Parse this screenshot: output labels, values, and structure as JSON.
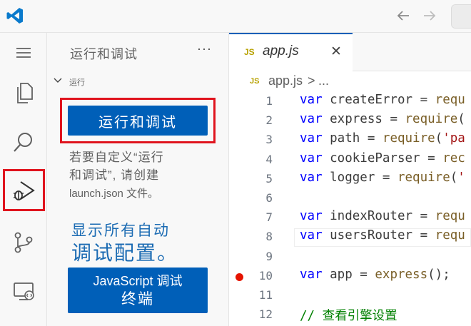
{
  "titlebar": {},
  "sidebar": {
    "title": "运行和调试",
    "more": "···",
    "section_title": "运行",
    "run_button": "运行和调试",
    "hint_line1": "若要自定义“运行",
    "hint_line2": "和调试”, 请创建",
    "hint_line3": "launch.json 文件。",
    "show_all_line1": "显示所有自动",
    "show_all_line2": "调试配置。",
    "js_button_line1": "JavaScript 调试",
    "js_button_line2": "终端"
  },
  "editor": {
    "tab_icon": "JS",
    "tab_name": "app.js",
    "tab_close": "✕",
    "breadcrumb_icon": "JS",
    "breadcrumb_file": "app.js",
    "breadcrumb_sep": ">",
    "breadcrumb_more": "...",
    "lines": [
      {
        "num": "1",
        "kw": "var",
        "name": " createError",
        "eq": " = ",
        "fn": "requ",
        "tail": ""
      },
      {
        "num": "2",
        "kw": "var",
        "name": " express",
        "eq": " = ",
        "fn": "require",
        "tail": "("
      },
      {
        "num": "3",
        "kw": "var",
        "name": " path",
        "eq": " = ",
        "fn": "require",
        "tail": "('pa"
      },
      {
        "num": "4",
        "kw": "var",
        "name": " cookieParser",
        "eq": " = ",
        "fn": "rec",
        "tail": ""
      },
      {
        "num": "5",
        "kw": "var",
        "name": " logger",
        "eq": " = ",
        "fn": "require",
        "tail": "('"
      },
      {
        "num": "6",
        "kw": "",
        "name": "",
        "eq": "",
        "fn": "",
        "tail": ""
      },
      {
        "num": "7",
        "kw": "var",
        "name": " indexRouter",
        "eq": " = ",
        "fn": "requ",
        "tail": ""
      },
      {
        "num": "8",
        "kw": "var",
        "name": " usersRouter",
        "eq": " = ",
        "fn": "requ",
        "tail": ""
      },
      {
        "num": "9",
        "kw": "",
        "name": "",
        "eq": "",
        "fn": "",
        "tail": ""
      },
      {
        "num": "10",
        "kw": "var",
        "name": " app",
        "eq": " = ",
        "fn": "express",
        "tail": "();"
      },
      {
        "num": "11",
        "kw": "",
        "name": "",
        "eq": "",
        "fn": "",
        "tail": ""
      },
      {
        "num": "12",
        "comment": "// 查看引擎设置"
      }
    ]
  },
  "icons": {
    "logo": "vscode-logo-icon",
    "back": "arrow-left-icon",
    "forward": "arrow-right-icon",
    "menu": "hamburger-menu-icon",
    "explorer": "files-icon",
    "search": "search-icon",
    "debug": "run-debug-icon",
    "scm": "source-control-icon",
    "remote": "remote-explorer-icon"
  },
  "colors": {
    "accent": "#005fb8",
    "highlight_box": "#e0141e",
    "breakpoint": "#e51400"
  }
}
